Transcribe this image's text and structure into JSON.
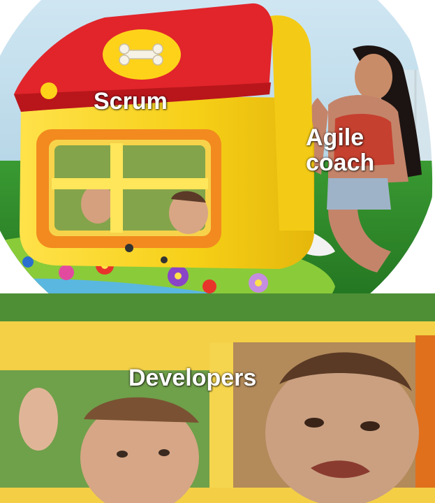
{
  "labels": {
    "scrum": "Scrum",
    "agile_line1": "Agile",
    "agile_line2": "coach",
    "developers": "Developers"
  },
  "colors": {
    "roof_red": "#e1252b",
    "roof_yellow": "#ffd21a",
    "house_yellow": "#f4d21c",
    "window_orange": "#f28a1f",
    "grass_green": "#2f8f2a",
    "sky_blue": "#b8d8e8"
  }
}
